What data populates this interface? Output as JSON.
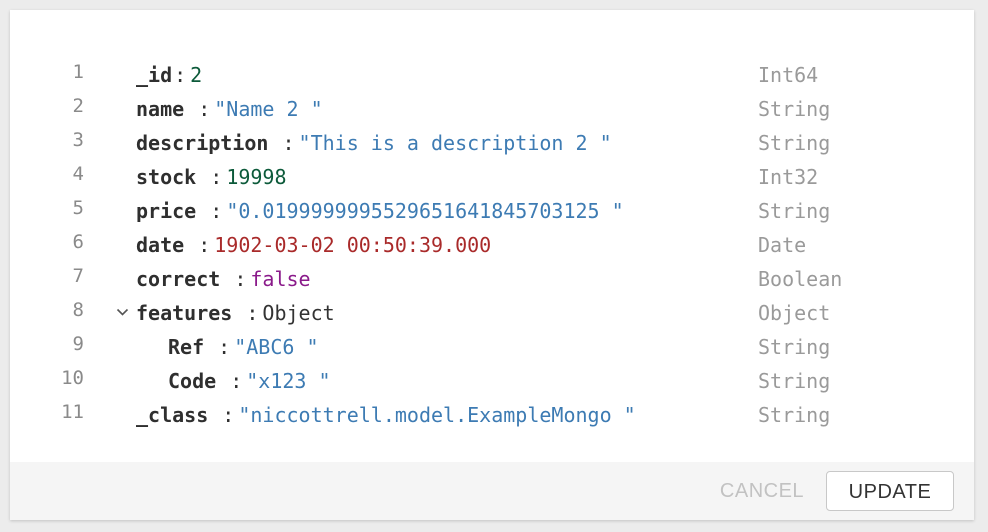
{
  "document": {
    "rows": [
      {
        "num": "1",
        "key": "_id",
        "sep": ":",
        "value": "2",
        "type": "Int64"
      },
      {
        "num": "2",
        "key": "name",
        "sep": " :",
        "value": "\"Name 2 \"",
        "type": "String"
      },
      {
        "num": "3",
        "key": "description",
        "sep": " :",
        "value": "\"This is a description 2 \"",
        "type": "String"
      },
      {
        "num": "4",
        "key": "stock",
        "sep": " :",
        "value": "19998",
        "type": "Int32"
      },
      {
        "num": "5",
        "key": "price",
        "sep": " :",
        "value": "\"0.0199999995529651641845703125 \"",
        "type": "String"
      },
      {
        "num": "6",
        "key": "date",
        "sep": " :",
        "value": "1902-03-02 00:50:39.000",
        "type": "Date"
      },
      {
        "num": "7",
        "key": "correct",
        "sep": " :",
        "value": "false",
        "type": "Boolean"
      },
      {
        "num": "8",
        "key": "features",
        "sep": " :",
        "value": "Object",
        "type": "Object"
      },
      {
        "num": "9",
        "key": "Ref",
        "sep": " :",
        "value": "\"ABC6 \"",
        "type": "String"
      },
      {
        "num": "10",
        "key": "Code",
        "sep": " :",
        "value": "\"x123 \"",
        "type": "String"
      },
      {
        "num": "11",
        "key": "_class",
        "sep": " :",
        "value": "\"niccottrell.model.ExampleMongo \"",
        "type": "String"
      }
    ]
  },
  "footer": {
    "cancel_label": "CANCEL",
    "update_label": "UPDATE"
  },
  "colors": {
    "int": "#0c5a3a",
    "string": "#3d7bb3",
    "date": "#a92a2a",
    "boolean": "#8a1a8a"
  }
}
